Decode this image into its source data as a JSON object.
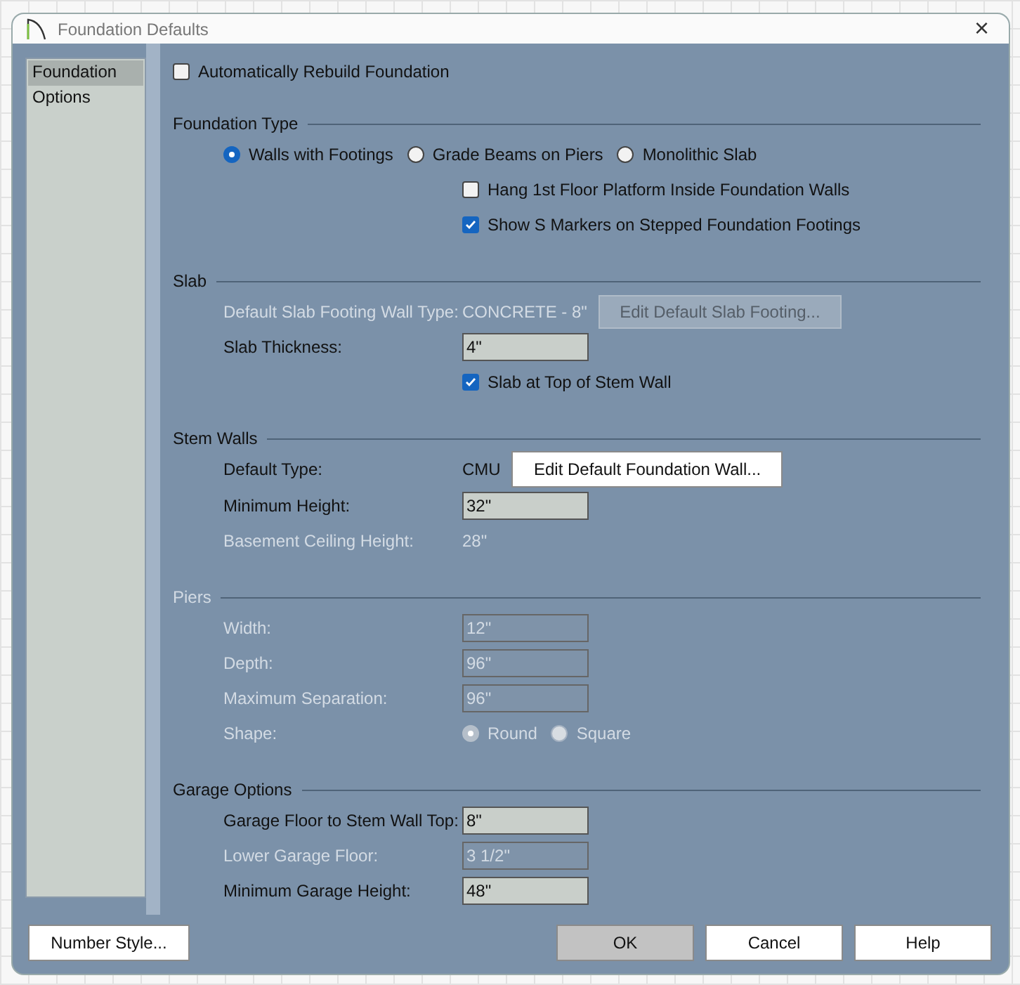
{
  "window": {
    "title": "Foundation Defaults",
    "close": "×"
  },
  "sidebar": {
    "items": [
      {
        "label": "Foundation",
        "selected": true
      },
      {
        "label": "Options",
        "selected": false
      }
    ]
  },
  "auto_rebuild": {
    "label": "Automatically Rebuild Foundation",
    "checked": false
  },
  "sections": [
    {
      "title": "Foundation Type",
      "disabled": false,
      "rows": [
        {
          "kind": "radios",
          "options": [
            {
              "label": "Walls with Footings",
              "selected": true
            },
            {
              "label": "Grade Beams on Piers",
              "selected": false
            },
            {
              "label": "Monolithic Slab",
              "selected": false
            }
          ]
        },
        {
          "kind": "checkbox",
          "label": "Hang 1st Floor Platform Inside Foundation Walls",
          "checked": false,
          "disabled": false
        },
        {
          "kind": "checkbox",
          "label": "Show S Markers on Stepped Foundation Footings",
          "checked": true,
          "disabled": false
        }
      ]
    },
    {
      "title": "Slab",
      "disabled": false,
      "rows": [
        {
          "kind": "text_button",
          "label": "Default Slab Footing Wall Type:",
          "value": "CONCRETE - 8\"",
          "button": "Edit Default Slab Footing...",
          "disabled": true
        },
        {
          "kind": "field",
          "label": "Slab Thickness:",
          "value": "4\"",
          "disabled": false
        },
        {
          "kind": "checkbox",
          "label": "Slab at Top of Stem Wall",
          "checked": true,
          "disabled": false
        }
      ]
    },
    {
      "title": "Stem Walls",
      "disabled": false,
      "rows": [
        {
          "kind": "text_button",
          "label": "Default Type:",
          "value": "CMU",
          "button": "Edit Default Foundation Wall...",
          "disabled": false
        },
        {
          "kind": "field",
          "label": "Minimum Height:",
          "value": "32\"",
          "disabled": false
        },
        {
          "kind": "readonly",
          "label": "Basement Ceiling Height:",
          "value": "28\"",
          "disabled": true
        }
      ]
    },
    {
      "title": "Piers",
      "disabled": true,
      "rows": [
        {
          "kind": "field",
          "label": "Width:",
          "value": "12\"",
          "disabled": true
        },
        {
          "kind": "field",
          "label": "Depth:",
          "value": "96\"",
          "disabled": true
        },
        {
          "kind": "field",
          "label": "Maximum Separation:",
          "value": "96\"",
          "disabled": true
        },
        {
          "kind": "labeled_radios",
          "label": "Shape:",
          "disabled": true,
          "options": [
            {
              "label": "Round",
              "selected": true
            },
            {
              "label": "Square",
              "selected": false
            }
          ]
        }
      ]
    },
    {
      "title": "Garage Options",
      "disabled": false,
      "rows": [
        {
          "kind": "field",
          "label": "Garage Floor to Stem Wall Top:",
          "value": "8\"",
          "disabled": false
        },
        {
          "kind": "field",
          "label": "Lower Garage Floor:",
          "value": "3 1/2\"",
          "disabled": true
        },
        {
          "kind": "field",
          "label": "Minimum Garage Height:",
          "value": "48\"",
          "disabled": false
        }
      ]
    }
  ],
  "buttons": [
    {
      "label": "Number Style...",
      "default": false
    },
    {
      "label": "OK",
      "default": true
    },
    {
      "label": "Cancel",
      "default": false
    },
    {
      "label": "Help",
      "default": false
    }
  ]
}
